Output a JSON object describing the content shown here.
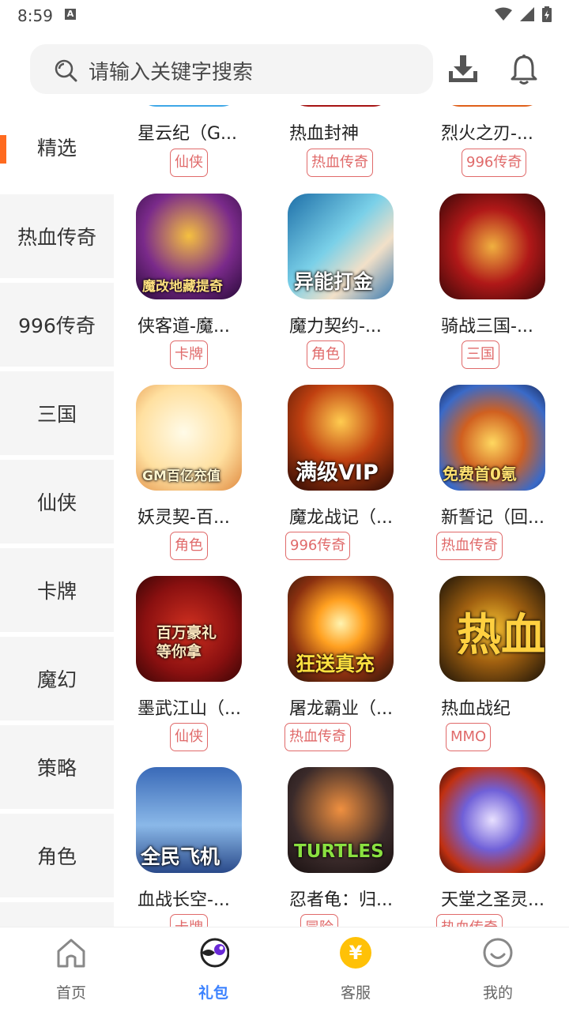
{
  "status": {
    "time": "8:59",
    "badge": "A"
  },
  "search": {
    "placeholder": "请输入关键字搜索"
  },
  "sidebar": {
    "items": [
      {
        "label": "精选"
      },
      {
        "label": "热血传奇"
      },
      {
        "label": "996传奇"
      },
      {
        "label": "三国"
      },
      {
        "label": "仙侠"
      },
      {
        "label": "卡牌"
      },
      {
        "label": "魔幻"
      },
      {
        "label": "策略"
      },
      {
        "label": "角色"
      }
    ]
  },
  "games": [
    {
      "name": "星云纪（G...",
      "tag": "仙侠"
    },
    {
      "name": "热血封神",
      "tag": "热血传奇"
    },
    {
      "name": "烈火之刃-...",
      "tag": "996传奇"
    },
    {
      "name": "侠客道-魔...",
      "tag": "卡牌",
      "art": "魔改地藏提奇"
    },
    {
      "name": "魔力契约-...",
      "tag": "角色",
      "art": "异能打金"
    },
    {
      "name": "骑战三国-...",
      "tag": "三国",
      "art": ""
    },
    {
      "name": "妖灵契-百...",
      "tag": "角色",
      "art": "GM百亿充值"
    },
    {
      "name": "魔龙战记（...",
      "tag": "996传奇",
      "art": "满级VIP"
    },
    {
      "name": "新誓记（回...",
      "tag": "热血传奇",
      "art": "免费首0氪"
    },
    {
      "name": "墨武江山（...",
      "tag": "仙侠",
      "art": "百万豪礼等你拿"
    },
    {
      "name": "屠龙霸业（...",
      "tag": "热血传奇",
      "art": "狂送真充"
    },
    {
      "name": "热血战纪",
      "tag": "MMO",
      "art": "热血"
    },
    {
      "name": "血战长空-...",
      "tag": "卡牌",
      "art": "全民飞机"
    },
    {
      "name": "忍者龟：归...",
      "tag": "冒险",
      "art": "TURTLES"
    },
    {
      "name": "天堂之圣灵...",
      "tag": "热血传奇",
      "art": ""
    }
  ],
  "tabbar": {
    "home": "首页",
    "gift": "礼包",
    "service": "客服",
    "mine": "我的",
    "service_symbol": "¥"
  },
  "colors": {
    "accent": "#ff6a1f",
    "tag": "#e06a6a",
    "active_tab": "#3c82ff",
    "service_coin": "#ffc107"
  }
}
